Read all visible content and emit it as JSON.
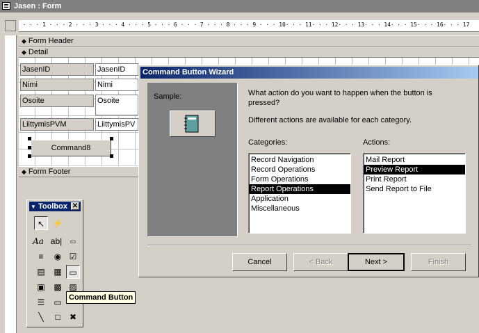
{
  "window": {
    "title": "Jasen : Form"
  },
  "ruler": {
    "marks": [
      "1",
      "2",
      "3",
      "4",
      "5",
      "6",
      "7",
      "8",
      "9",
      "10",
      "11",
      "12",
      "13",
      "14",
      "15",
      "16",
      "17"
    ]
  },
  "sections": {
    "form_header": "Form Header",
    "detail": "Detail",
    "form_footer": "Form Footer"
  },
  "fields": [
    {
      "label": "JasenID",
      "control": "JasenID"
    },
    {
      "label": "Nimi",
      "control": "Nimi"
    },
    {
      "label": "Osoite",
      "control": "Osoite"
    },
    {
      "label": "LiittymisPVM",
      "control": "LiittymisPV"
    }
  ],
  "command_button": {
    "label": "Command8"
  },
  "toolbox": {
    "title": "Toolbox",
    "tooltip": "Command Button"
  },
  "wizard": {
    "title": "Command Button Wizard",
    "sample_label": "Sample:",
    "question": "What action do you want to happen when the button is pressed?",
    "hint": "Different actions are available for each category.",
    "categories_label": "Categories:",
    "actions_label": "Actions:",
    "categories": [
      "Record Navigation",
      "Record Operations",
      "Form Operations",
      "Report Operations",
      "Application",
      "Miscellaneous"
    ],
    "selected_category": "Report Operations",
    "actions": [
      "Mail Report",
      "Preview Report",
      "Print Report",
      "Send Report to File"
    ],
    "selected_action": "Preview Report",
    "buttons": {
      "cancel": "Cancel",
      "back": "< Back",
      "next": "Next >",
      "finish": "Finish"
    }
  },
  "colors": {
    "title_active": "#0a246a",
    "title_inactive": "#808080",
    "selection": "#000000",
    "face": "#d4d0c8"
  }
}
